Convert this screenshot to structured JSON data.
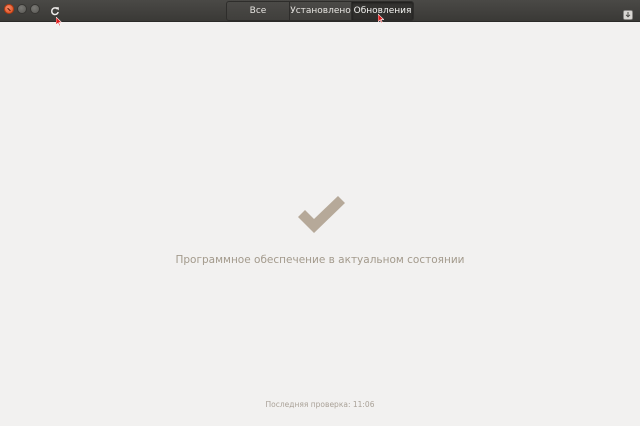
{
  "header": {
    "tabs": [
      {
        "label": "Все"
      },
      {
        "label": "Установлено"
      },
      {
        "label": "Обновления"
      }
    ],
    "active_tab": "Обновления"
  },
  "main": {
    "status_message": "Программное обеспечение в актуальном состоянии",
    "last_check": "Последняя проверка: 11:06"
  },
  "icons": {
    "window_close": "close-icon",
    "window_minimize": "minimize-icon",
    "window_maximize": "maximize-icon",
    "refresh": "refresh-icon",
    "download": "download-icon",
    "status": "checkmark-icon"
  },
  "colors": {
    "background": "#f2f1f0",
    "headerbar": "#3f3e3b",
    "close_button": "#df4a16",
    "checkmark": "#b6a999",
    "status_text": "#a39a8c",
    "cursor": "#e01b1b"
  }
}
